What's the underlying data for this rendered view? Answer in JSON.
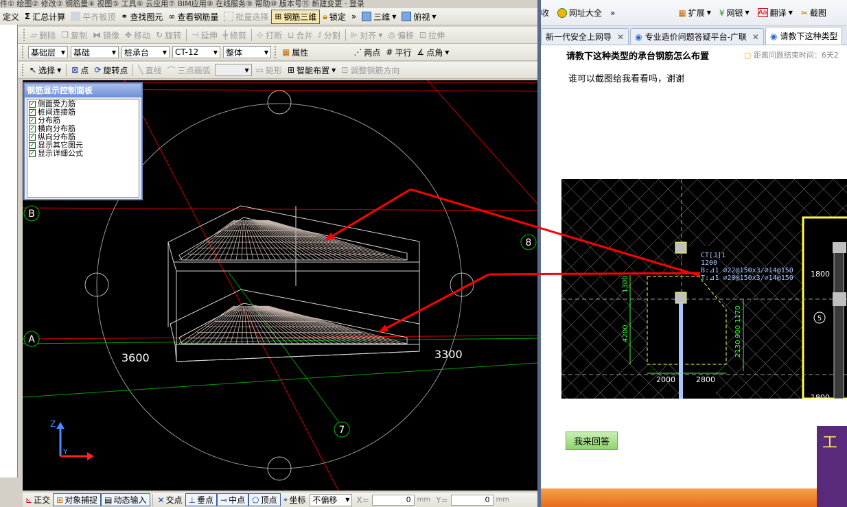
{
  "cad_app": {
    "menu_fragment": "件① 绘图② 修改③ 钢筋量④ 视图⑤ 工具⑥ 云应用⑦ BIM应用⑧ 在线服务⑨ 帮助⑩ 版本号⑪ 新建变更 · 登录",
    "toolbar1": {
      "define": "定义",
      "sum_calc": "汇总计算",
      "flat_board": "平齐板顶",
      "find_element": "查找图元",
      "view_rebar": "查看钢筋量",
      "batch_select": "批量选择",
      "rebar_3d": "钢筋三维",
      "lock": "锁定",
      "view_3d": "三维",
      "top_view": "俯视",
      "more": "»"
    },
    "toolbar2": {
      "delete": "删除",
      "copy": "复制",
      "mirror": "镜像",
      "move": "移动",
      "rotate": "旋转",
      "extend": "延伸",
      "trim": "修剪",
      "break": "打断",
      "merge": "合并",
      "split": "分割",
      "align": "对齐",
      "offset": "偏移",
      "stretch": "拉伸"
    },
    "toolbar3": {
      "layer": "基础层",
      "category": "基础",
      "element_type": "桩承台",
      "element_name": "CT-12",
      "scope": "整体",
      "properties": "属性",
      "two_points": "两点",
      "parallel": "平行",
      "point_angle": "点角"
    },
    "toolbar4": {
      "select": "选择",
      "point": "点",
      "rotate_point": "旋转点",
      "line": "直线",
      "three_point_arc": "三点画弧",
      "rectangle": "矩形",
      "smart_layout": "智能布置",
      "adjust_rebar_dir": "调整钢筋方向"
    },
    "control_panel": {
      "title": "钢筋显示控制面板",
      "items": [
        {
          "label": "侧面受力筋",
          "checked": true
        },
        {
          "label": "桩间连接筋",
          "checked": true
        },
        {
          "label": "分布筋",
          "checked": true
        },
        {
          "label": "横向分布筋",
          "checked": true
        },
        {
          "label": "纵向分布筋",
          "checked": true
        },
        {
          "label": "显示其它图元",
          "checked": true
        },
        {
          "label": "显示详细公式",
          "checked": true
        }
      ]
    },
    "viewport": {
      "axis_b": "B",
      "axis_a": "A",
      "axis_8": "8",
      "axis_7": "7",
      "dim_left": "3600",
      "dim_right": "3300",
      "ucs_z": "Z",
      "ucs_y": "Y"
    },
    "statusbar": {
      "ortho": "正交",
      "snap": "对象捕捉",
      "dynamic_input": "动态输入",
      "intersection": "交点",
      "perpendicular": "垂点",
      "midpoint": "中点",
      "vertex": "顶点",
      "coordinate": "坐标",
      "offset_mode": "不偏移",
      "x_label": "X=",
      "x_value": "0",
      "y_label": "Y=",
      "y_value": "0",
      "unit": "mm"
    }
  },
  "browser": {
    "toolbar": {
      "fav": "收",
      "site_nav": "网址大全",
      "ext": "扩展",
      "bank": "网银",
      "translate": "翻译",
      "screenshot": "截图"
    },
    "tabs": [
      {
        "label": "新一代安全上网导",
        "active": false
      },
      {
        "label": "专业造价问题答疑平台-广联",
        "active": false
      },
      {
        "label": "请教下这种类型",
        "active": true
      }
    ],
    "question": {
      "title": "请教下这种类型的承台钢筋怎么布置",
      "meta": "距离问题结束时间：6天2",
      "body": "谁可以截图给我看看吗，谢谢"
    },
    "cad_image": {
      "label_name": "CT[J]1",
      "label_h": "1200",
      "label_b": "B:⊿1 ⌀22@150x3/⌀14@150",
      "label_t": "T:⊿1 ⌀20@150x3/⌀14@150",
      "dim_1300": "1300",
      "dim_4200": "4200",
      "dim_2000": "2000",
      "dim_2800": "2800",
      "dim_900_1170": "900 1170",
      "dim_2130": "2130",
      "dim_1800_top": "1800",
      "dim_1800_bot": "1800",
      "axis_5": "5"
    },
    "answer_button": "我来回答",
    "ad_text": "工"
  },
  "colors": {
    "annotation_arrow": "#ff0000",
    "cad_background": "#000000",
    "rebar": "#c8b6ae",
    "grid_green": "#00a000"
  }
}
